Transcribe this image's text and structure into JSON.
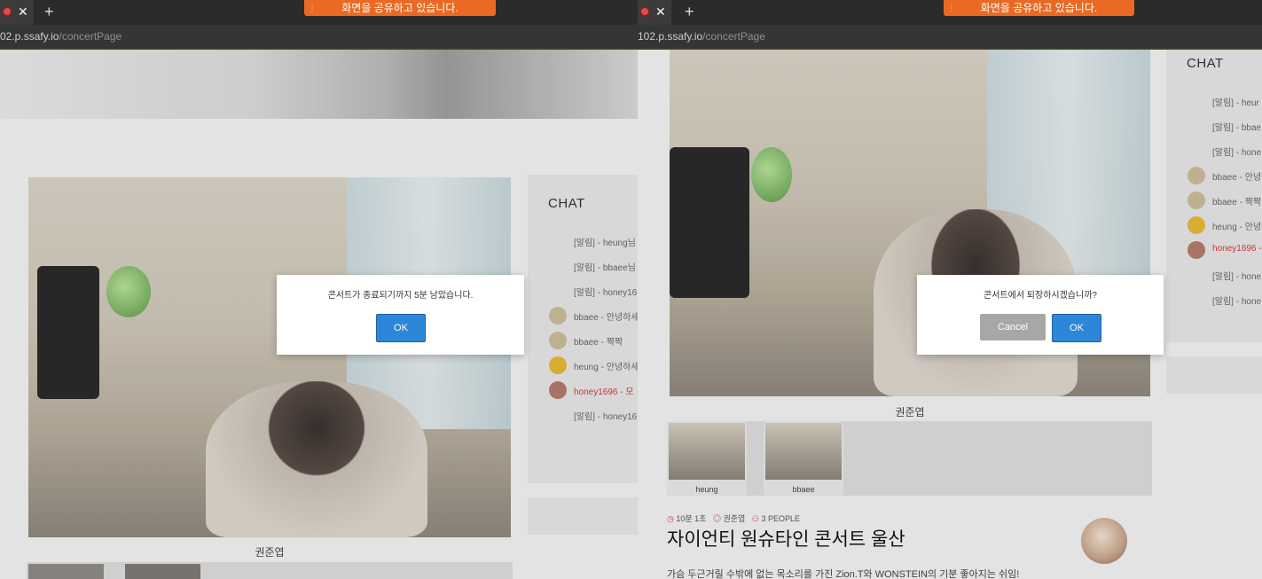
{
  "share_banner": "화면을 공유하고 있습니다.",
  "left": {
    "url_host": "02.p.ssafy.io",
    "url_path": "/concertPage",
    "video_name": "권준엽",
    "dialog": {
      "message": "콘서트가 종료되기까지 5분 남았습니다.",
      "ok": "OK"
    },
    "chat": {
      "title": "CHAT",
      "rows": [
        {
          "text": "[알림] - heung님",
          "avatar": ""
        },
        {
          "text": "[알림] - bbaee님",
          "avatar": ""
        },
        {
          "text": "[알림] - honey16",
          "avatar": ""
        },
        {
          "text": "bbaee - 안녕하세",
          "avatar": "plain"
        },
        {
          "text": "bbaee - 짝짝",
          "avatar": "plain"
        },
        {
          "text": "heung - 안녕하세",
          "avatar": "gold"
        },
        {
          "text": "honey1696 - 모",
          "avatar": "brown",
          "red": true
        },
        {
          "text": "[알림] - honey16",
          "avatar": ""
        }
      ]
    }
  },
  "right": {
    "url_host": "102.p.ssafy.io",
    "url_path": "/concertPage",
    "video_name": "권준엽",
    "dialog": {
      "message": "콘서트에서 퇴장하시겠습니까?",
      "cancel": "Cancel",
      "ok": "OK"
    },
    "thumbs": [
      {
        "label": "heung"
      },
      {
        "label": "bbaee"
      }
    ],
    "meta": {
      "time": "10분 1초",
      "host": "권준엽",
      "people": "3 PEOPLE"
    },
    "title": "자이언티 원슈타인 콘서트 울산",
    "description": "가슴 두근거릴 수밖에 없는 목소리를 가진 Zion.T와 WONSTEIN의 기분 좋아지는 쉬임!",
    "chat": {
      "title": "CHAT",
      "rows": [
        {
          "text": "[알림] - heur",
          "avatar": ""
        },
        {
          "text": "[알림] - bbae",
          "avatar": ""
        },
        {
          "text": "[알림] - hone",
          "avatar": ""
        },
        {
          "text": "bbaee - 안녕",
          "avatar": "plain"
        },
        {
          "text": "bbaee - 짝짝",
          "avatar": "plain"
        },
        {
          "text": "heung - 안녕",
          "avatar": "gold"
        },
        {
          "text": "honey1696 -",
          "avatar": "brown",
          "red": true
        },
        {
          "text": "[알림] - hone",
          "avatar": ""
        },
        {
          "text": "[알림] - hone",
          "avatar": ""
        }
      ]
    }
  }
}
